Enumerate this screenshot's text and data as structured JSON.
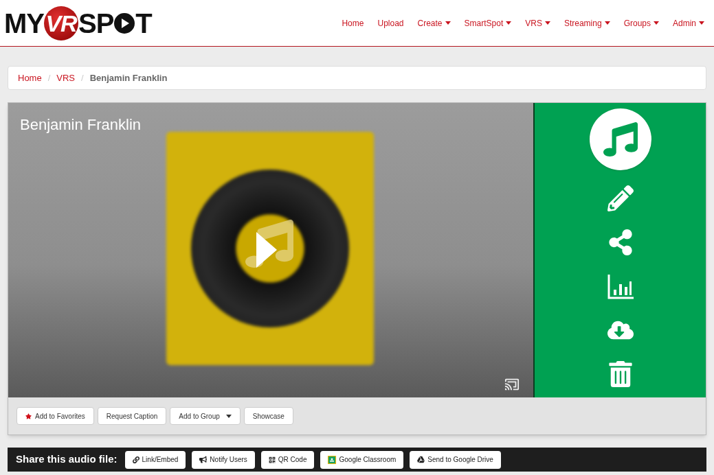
{
  "logo": {
    "left": "MY",
    "badge": "VR",
    "right_a": "SP",
    "right_b": "T"
  },
  "nav": [
    {
      "label": "Home",
      "dropdown": false
    },
    {
      "label": "Upload",
      "dropdown": false
    },
    {
      "label": "Create",
      "dropdown": true
    },
    {
      "label": "SmartSpot",
      "dropdown": true
    },
    {
      "label": "VRS",
      "dropdown": true
    },
    {
      "label": "Streaming",
      "dropdown": true
    },
    {
      "label": "Groups",
      "dropdown": true
    },
    {
      "label": "Admin",
      "dropdown": true
    }
  ],
  "breadcrumb_separator": "/",
  "breadcrumb": [
    {
      "label": "Home",
      "current": false
    },
    {
      "label": "VRS",
      "current": false
    },
    {
      "label": "Benjamin Franklin",
      "current": true
    }
  ],
  "media": {
    "title": "Benjamin Franklin"
  },
  "actions": [
    {
      "label": "Add to Favorites",
      "kind": "favorite"
    },
    {
      "label": "Request Caption",
      "kind": "plain"
    },
    {
      "label": "Add to Group",
      "kind": "dropdown"
    },
    {
      "label": "Showcase",
      "kind": "plain"
    }
  ],
  "share": {
    "label": "Share this audio file:",
    "buttons": [
      {
        "label": "Link/Embed",
        "kind": "link"
      },
      {
        "label": "Notify Users",
        "kind": "megaphone"
      },
      {
        "label": "QR Code",
        "kind": "qr"
      },
      {
        "label": "Google Classroom",
        "kind": "classroom"
      },
      {
        "label": "Send to Google Drive",
        "kind": "drive"
      }
    ]
  }
}
